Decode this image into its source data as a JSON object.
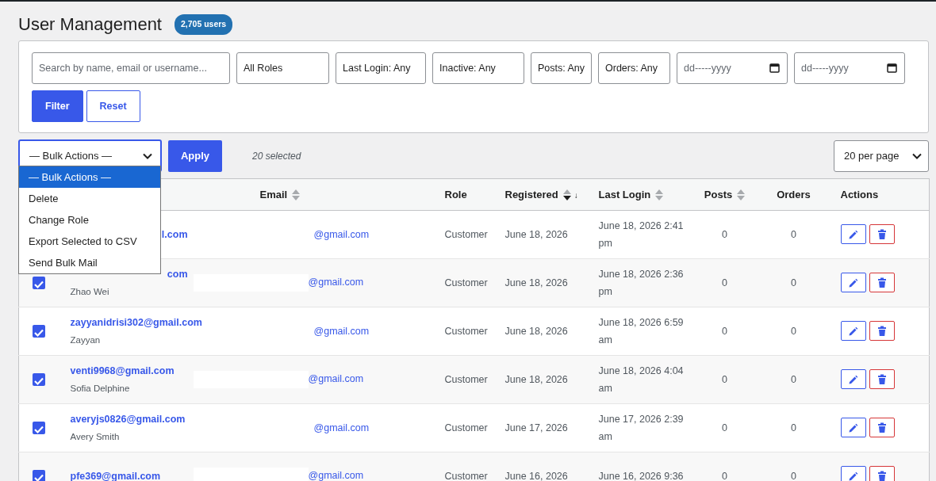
{
  "page": {
    "title": "User Management",
    "count_badge": "2,705 users"
  },
  "filters": {
    "search": {
      "placeholder": "Search by name, email or username..."
    },
    "selects": [
      {
        "label": "All Roles"
      },
      {
        "label": "Last Login: Any"
      },
      {
        "label": "Inactive: Any"
      },
      {
        "label": "Posts: Any"
      },
      {
        "label": "Orders: Any"
      }
    ],
    "dates": [
      {
        "placeholder": "dd-----yyyy"
      },
      {
        "placeholder": "dd-----yyyy"
      }
    ],
    "buttons": [
      {
        "label": "Filter",
        "kind": "primary"
      },
      {
        "label": "Reset",
        "kind": "outline"
      }
    ]
  },
  "bulk_actions": {
    "value": "— Bulk Actions —",
    "expanded": true,
    "options": [
      {
        "label": "— Bulk Actions —",
        "selected": true
      },
      {
        "label": "Delete",
        "selected": false
      },
      {
        "label": "Change Role",
        "selected": false
      },
      {
        "label": "Export Selected to CSV",
        "selected": false
      },
      {
        "label": "Send Bulk Mail",
        "selected": false
      }
    ]
  },
  "apply_button": "Apply",
  "selection_count": "20 selected",
  "per_page": "20 per page",
  "table": {
    "columns": [
      {
        "label": "Email",
        "sortable": true,
        "sorted_descending": false
      },
      {
        "label": "Role",
        "sortable": false
      },
      {
        "label": "Registered",
        "sortable": true,
        "sorted_descending": true,
        "sort_mark": "↓"
      },
      {
        "label": "Last Login",
        "sortable": true,
        "sorted_descending": false
      },
      {
        "label": "Posts",
        "sortable": true,
        "sorted_descending": false
      },
      {
        "label": "Orders",
        "sortable": false
      },
      {
        "label": "Actions",
        "sortable": false
      }
    ],
    "rows": [
      {
        "user_email": "l.com",
        "clipped": true,
        "email": "@gmail.com",
        "redacted": false,
        "role": "Customer",
        "registered": "June 18, 2026",
        "last_login": "June 18, 2026 2:41 pm",
        "posts": "0",
        "orders": "0"
      },
      {
        "checked": true,
        "user_email": "com",
        "clipped": true,
        "name": "Zhao Wei",
        "email": "@gmail.com",
        "redacted": true,
        "role": "Customer",
        "registered": "June 18, 2026",
        "last_login": "June 18, 2026 2:36 pm",
        "posts": "0",
        "orders": "0"
      },
      {
        "checked": true,
        "user_email": "zayyanidrisi302@gmail.com",
        "clipped": false,
        "name": "Zayyan",
        "email": "@gmail.com",
        "redacted": false,
        "role": "Customer",
        "registered": "June 18, 2026",
        "last_login": "June 18, 2026 6:59 am",
        "posts": "0",
        "orders": "0"
      },
      {
        "checked": true,
        "user_email": "venti9968@gmail.com",
        "clipped": false,
        "name": "Sofia Delphine",
        "email": "@gmail.com",
        "redacted": true,
        "role": "Customer",
        "registered": "June 18, 2026",
        "last_login": "June 18, 2026 4:04 am",
        "posts": "0",
        "orders": "0"
      },
      {
        "checked": true,
        "user_email": "averyjs0826@gmail.com",
        "clipped": false,
        "name": "Avery Smith",
        "email": "@gmail.com",
        "redacted": false,
        "role": "Customer",
        "registered": "June 17, 2026",
        "last_login": "June 17, 2026 2:39 am",
        "posts": "0",
        "orders": "0"
      },
      {
        "checked": true,
        "user_email": "pfe369@gmail.com",
        "clipped": false,
        "email": "@gmail.com",
        "redacted": true,
        "role": "Customer",
        "registered": "June 16, 2026",
        "last_login": "June 16, 2026 9:36",
        "posts": "0",
        "orders": "0"
      }
    ]
  }
}
